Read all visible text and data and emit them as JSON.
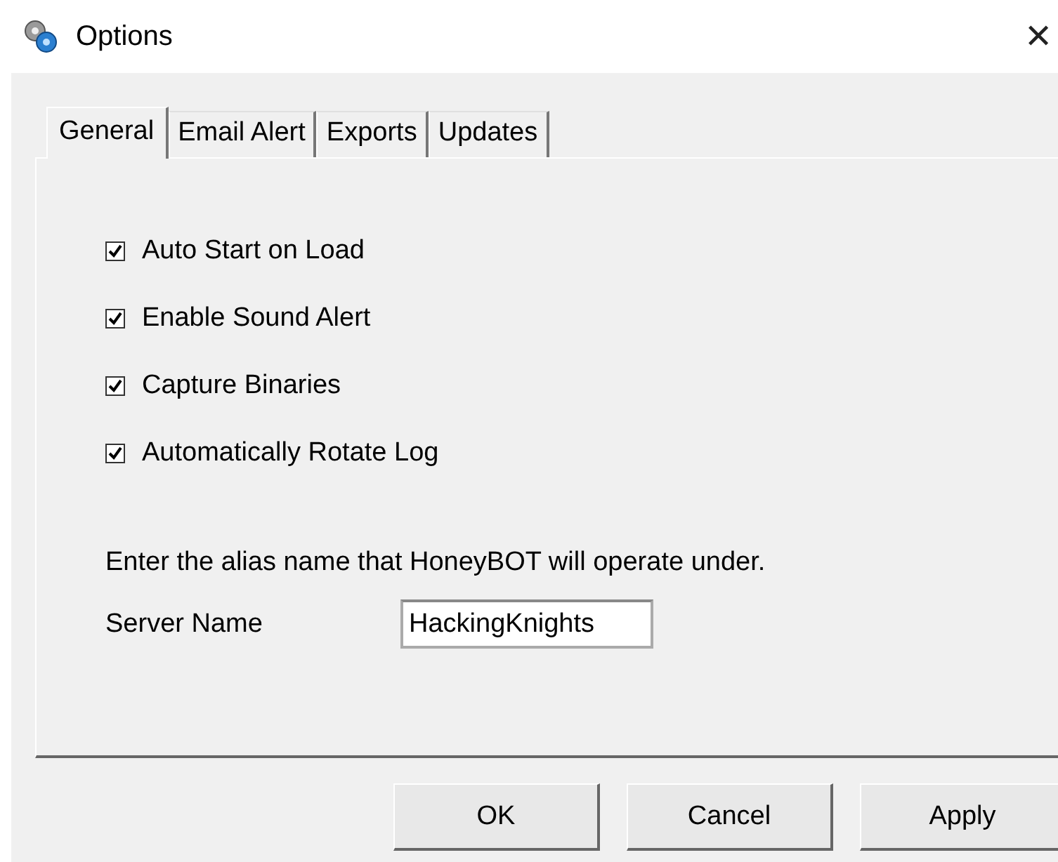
{
  "window": {
    "title": "Options",
    "close": "✕"
  },
  "tabs": [
    {
      "label": "General",
      "selected": true
    },
    {
      "label": "Email Alert",
      "selected": false
    },
    {
      "label": "Exports",
      "selected": false
    },
    {
      "label": "Updates",
      "selected": false
    }
  ],
  "options": [
    {
      "label": "Auto Start on Load",
      "checked": true
    },
    {
      "label": "Enable Sound Alert",
      "checked": true
    },
    {
      "label": "Capture Binaries",
      "checked": true
    },
    {
      "label": "Automatically Rotate Log",
      "checked": true
    }
  ],
  "description": "Enter the alias name that HoneyBOT will operate under.",
  "server_name": {
    "label": "Server Name",
    "value": "HackingKnights"
  },
  "buttons": [
    "OK",
    "Cancel",
    "Apply"
  ]
}
